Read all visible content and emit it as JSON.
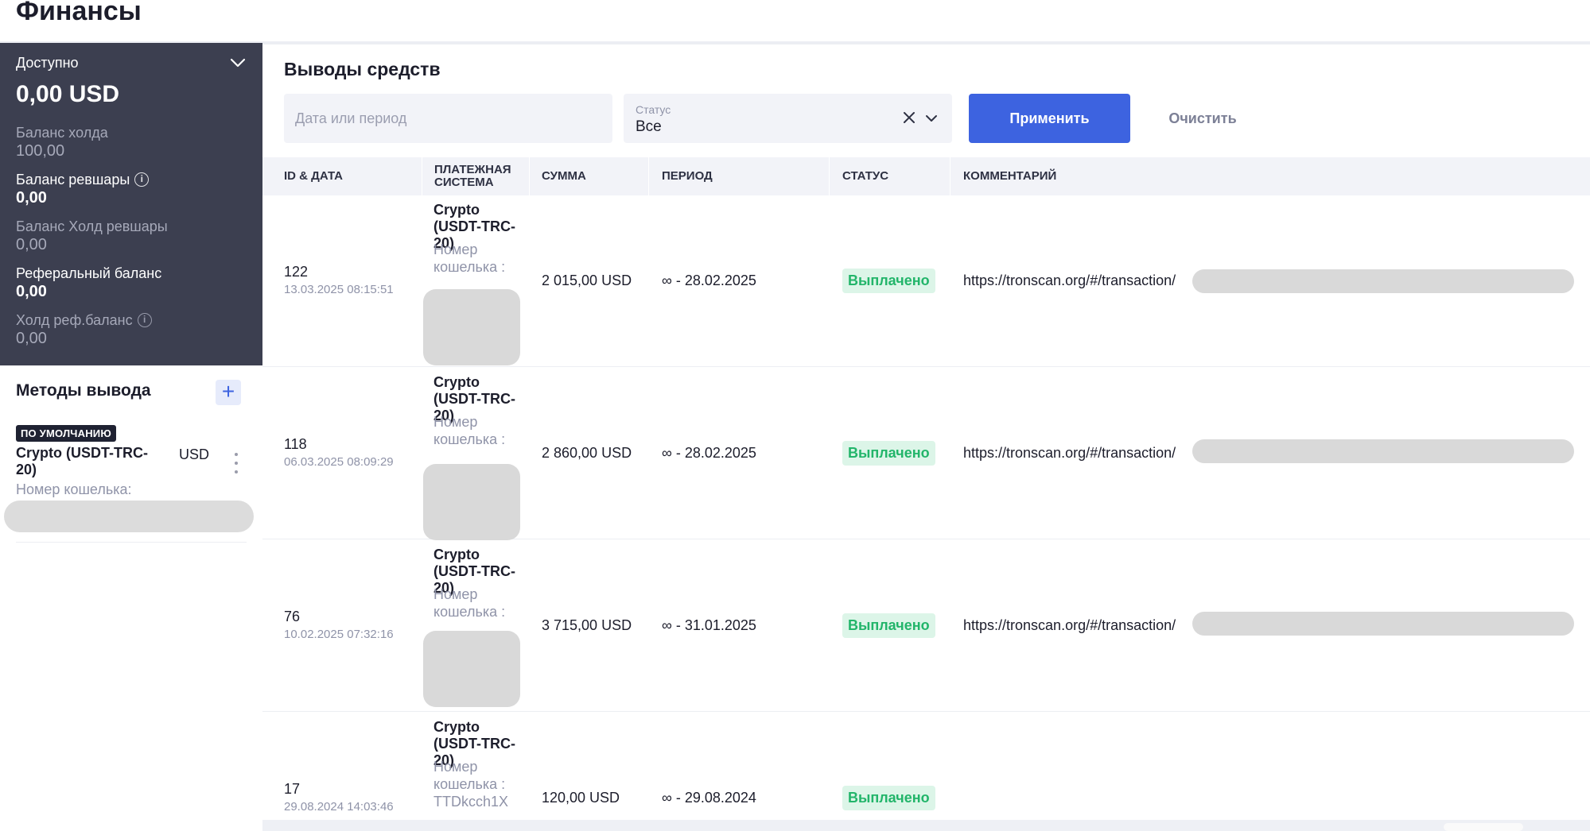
{
  "page_title": "Финансы",
  "balance": {
    "available_label": "Доступно",
    "available_amount": "0,00 USD",
    "items": [
      {
        "label": "Баланс холда",
        "value": "100,00"
      },
      {
        "label": "Баланс ревшары",
        "value": "0,00"
      },
      {
        "label": "Баланс Холд ревшары",
        "value": "0,00"
      },
      {
        "label": "Реферальный баланс",
        "value": "0,00"
      },
      {
        "label": "Холд реф.баланс",
        "value": "0,00"
      }
    ]
  },
  "methods": {
    "title": "Методы вывода",
    "add_symbol": "+",
    "default_badge": "ПО УМОЛЧАНИЮ",
    "method_name": "Crypto (USDT-TRC-20)",
    "currency": "USD",
    "wallet_label": "Номер кошелька:"
  },
  "withdrawals": {
    "title": "Выводы средств",
    "date_placeholder": "Дата или период",
    "status_label": "Статус",
    "status_value": "Все",
    "apply_label": "Применить",
    "clear_label": "Очистить",
    "columns": [
      "ID & ДАТА",
      "ПЛАТЕЖНАЯ СИСТЕМА",
      "СУММА",
      "ПЕРИОД",
      "СТАТУС",
      "КОММЕНТАРИЙ"
    ],
    "rows": [
      {
        "id": "122",
        "date": "13.03.2025 08:15:51",
        "system": "Crypto (USDT-TRC-20)",
        "wallet_label": "Номер кошелька :",
        "sum": "2 015,00 USD",
        "period": "∞ - 28.02.2025",
        "status": "Выплачено",
        "comment": "https://tronscan.org/#/transaction/"
      },
      {
        "id": "118",
        "date": "06.03.2025 08:09:29",
        "system": "Crypto (USDT-TRC-20)",
        "wallet_label": "Номер кошелька :",
        "sum": "2 860,00 USD",
        "period": "∞ - 28.02.2025",
        "status": "Выплачено",
        "comment": "https://tronscan.org/#/transaction/"
      },
      {
        "id": "76",
        "date": "10.02.2025 07:32:16",
        "system": "Crypto (USDT-TRC-20)",
        "wallet_label": "Номер кошелька :",
        "sum": "3 715,00 USD",
        "period": "∞ - 31.01.2025",
        "status": "Выплачено",
        "comment": "https://tronscan.org/#/transaction/"
      },
      {
        "id": "17",
        "date": "29.08.2024 14:03:46",
        "system": "Crypto (USDT-TRC-20)",
        "wallet_label": "Номер кошелька : TTDkcch1X",
        "sum": "120,00 USD",
        "period": "∞ - 29.08.2024",
        "status": "Выплачено",
        "comment": ""
      }
    ]
  },
  "icons": {
    "available_toggle": "chevron-down-icon",
    "info": "info-icon",
    "add": "plus-icon",
    "menu": "kebab-icon",
    "status_clear": "close-icon",
    "status_expand": "chevron-down-icon"
  },
  "colors": {
    "sidebar_bg": "#3c3f50",
    "accent": "#3d63e0",
    "paid_text": "#22b56a",
    "paid_bg": "#dcf5e8"
  }
}
